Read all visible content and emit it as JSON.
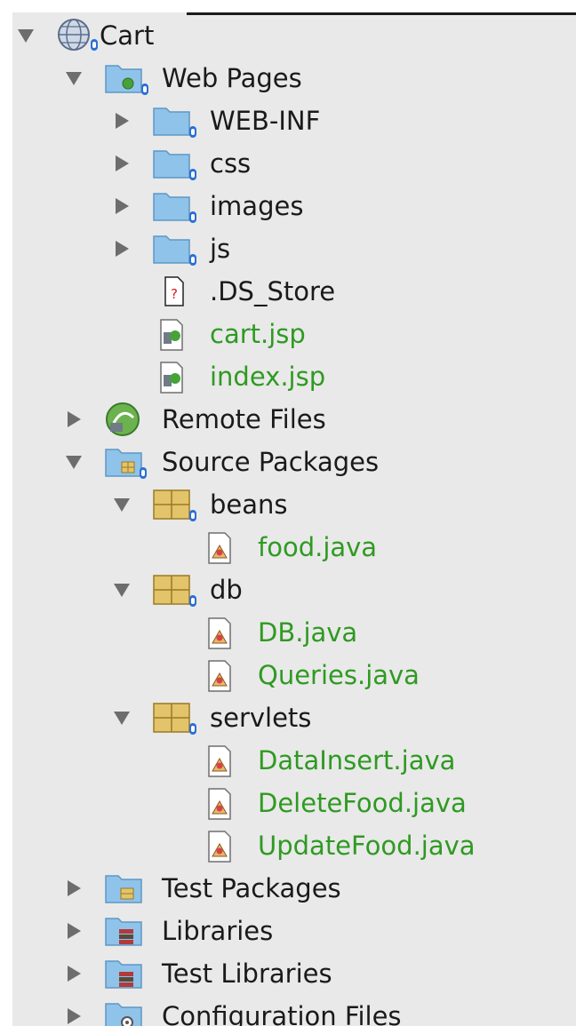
{
  "project_tree": {
    "nodes": [
      {
        "label": "Cart",
        "state": "expanded",
        "icon": "web-project-icon",
        "color": "default"
      },
      {
        "label": "Web Pages",
        "state": "expanded",
        "icon": "web-pages-folder-icon",
        "color": "default"
      },
      {
        "label": "WEB-INF",
        "state": "collapsed",
        "icon": "folder-icon",
        "color": "default"
      },
      {
        "label": "css",
        "state": "collapsed",
        "icon": "folder-icon",
        "color": "default"
      },
      {
        "label": "images",
        "state": "collapsed",
        "icon": "folder-icon",
        "color": "default"
      },
      {
        "label": "js",
        "state": "collapsed",
        "icon": "folder-icon",
        "color": "default"
      },
      {
        "label": ".DS_Store",
        "state": "leaf",
        "icon": "unknown-file-icon",
        "color": "default"
      },
      {
        "label": "cart.jsp",
        "state": "leaf",
        "icon": "jsp-file-icon",
        "color": "green"
      },
      {
        "label": "index.jsp",
        "state": "leaf",
        "icon": "jsp-file-icon",
        "color": "green"
      },
      {
        "label": "Remote Files",
        "state": "collapsed",
        "icon": "remote-files-icon",
        "color": "default"
      },
      {
        "label": "Source Packages",
        "state": "expanded",
        "icon": "source-packages-folder-icon",
        "color": "default"
      },
      {
        "label": "beans",
        "state": "expanded",
        "icon": "package-icon",
        "color": "default"
      },
      {
        "label": "food.java",
        "state": "leaf",
        "icon": "java-file-icon",
        "color": "green"
      },
      {
        "label": "db",
        "state": "expanded",
        "icon": "package-icon",
        "color": "default"
      },
      {
        "label": "DB.java",
        "state": "leaf",
        "icon": "java-file-icon",
        "color": "green"
      },
      {
        "label": "Queries.java",
        "state": "leaf",
        "icon": "java-file-icon",
        "color": "green"
      },
      {
        "label": "servlets",
        "state": "expanded",
        "icon": "package-icon",
        "color": "default"
      },
      {
        "label": "DataInsert.java",
        "state": "leaf",
        "icon": "java-file-icon",
        "color": "green"
      },
      {
        "label": "DeleteFood.java",
        "state": "leaf",
        "icon": "java-file-icon",
        "color": "green"
      },
      {
        "label": "UpdateFood.java",
        "state": "leaf",
        "icon": "java-file-icon",
        "color": "green"
      },
      {
        "label": "Test Packages",
        "state": "collapsed",
        "icon": "test-packages-folder-icon",
        "color": "default"
      },
      {
        "label": "Libraries",
        "state": "collapsed",
        "icon": "libraries-folder-icon",
        "color": "default"
      },
      {
        "label": "Test Libraries",
        "state": "collapsed",
        "icon": "libraries-folder-icon",
        "color": "default"
      },
      {
        "label": "Configuration Files",
        "state": "collapsed",
        "icon": "configuration-folder-icon",
        "color": "default"
      }
    ]
  },
  "colors": {
    "background": "#e9e9e9",
    "modified_text": "#2f9a22",
    "default_text": "#1a1a1a",
    "folder": "#8fc3ea",
    "package": "#e3c46a",
    "versioned_badge": "#2a6fd6"
  }
}
